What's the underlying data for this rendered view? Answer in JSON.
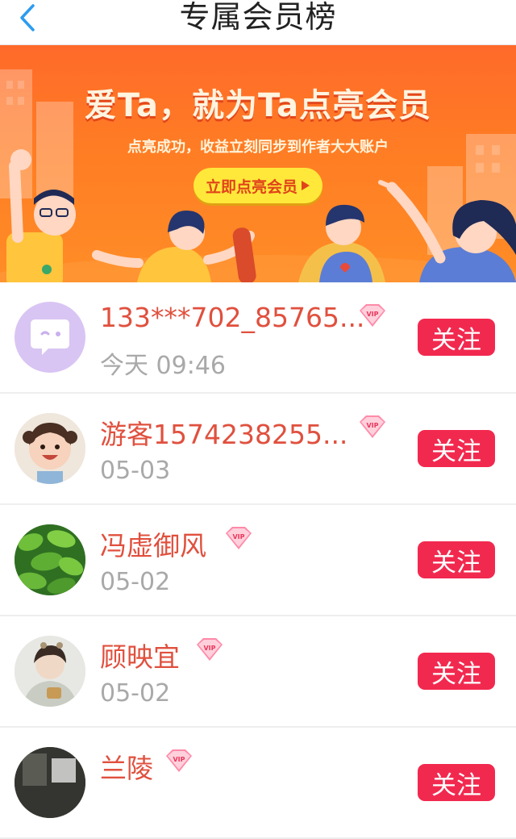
{
  "header": {
    "title": "专属会员榜",
    "back_icon": "chevron-left-icon"
  },
  "banner": {
    "headline": "爱Ta，就为Ta点亮会员",
    "subline": "点亮成功，收益立刻同步到作者大大账户",
    "cta_label": "立即点亮会员",
    "colors": {
      "background": "#ff7424",
      "cta_background": "#ffe83a",
      "cta_text": "#e0431a"
    }
  },
  "members": [
    {
      "name": "133***702_85765...",
      "date": "今天 09:46",
      "badge": "VIP",
      "follow_label": "关注",
      "avatar": "chat-bubble-avatar"
    },
    {
      "name": "游客1574238255...",
      "date": "05-03",
      "badge": "VIP",
      "follow_label": "关注",
      "avatar": "child-photo-avatar"
    },
    {
      "name": "冯虚御风",
      "date": "05-02",
      "badge": "VIP",
      "follow_label": "关注",
      "avatar": "green-plant-avatar"
    },
    {
      "name": "顾映宜",
      "date": "05-02",
      "badge": "VIP",
      "follow_label": "关注",
      "avatar": "portrait-photo-avatar"
    },
    {
      "name": "兰陵",
      "date": "",
      "badge": "VIP",
      "follow_label": "关注",
      "avatar": "dark-photo-avatar"
    }
  ],
  "colors": {
    "accent": "#f2294f",
    "username": "#e0503e",
    "date": "#a9a9a9",
    "back_arrow": "#2c9cf0"
  }
}
